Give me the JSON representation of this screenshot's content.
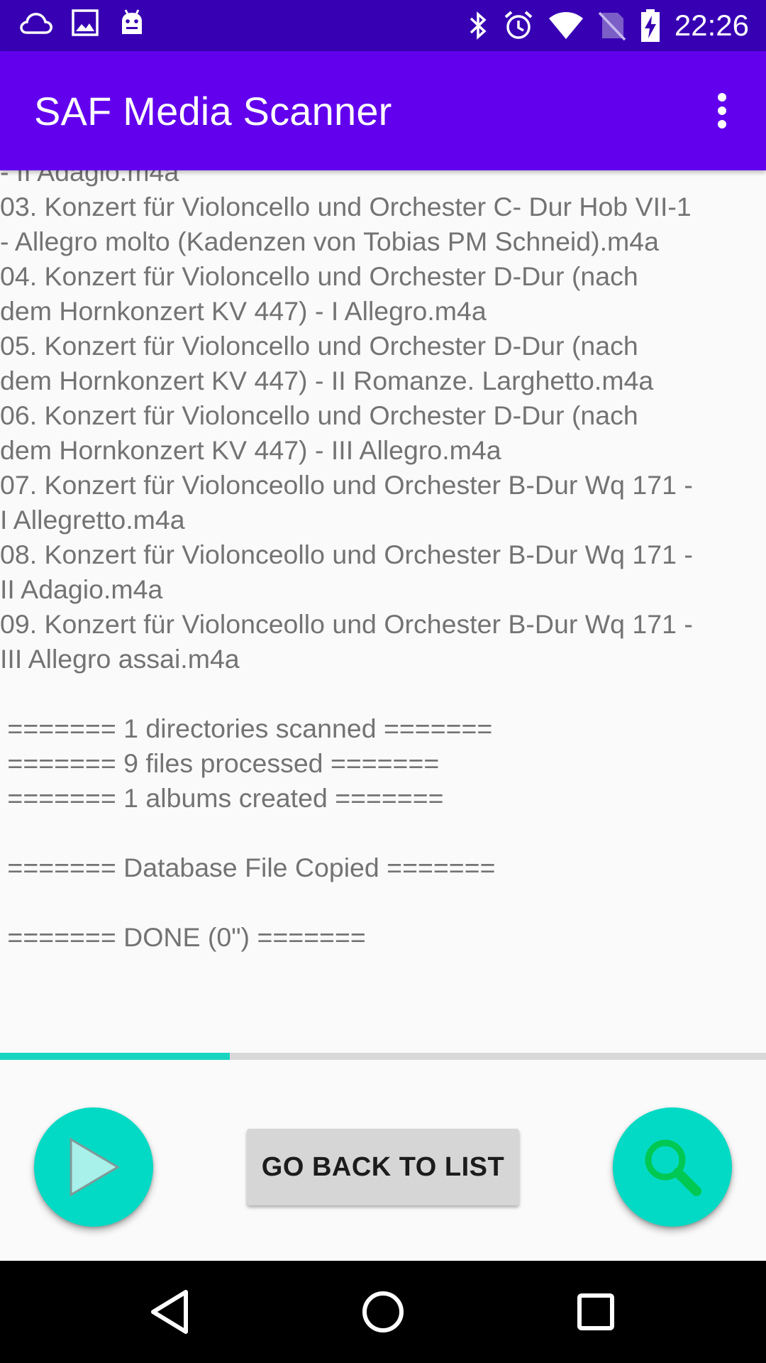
{
  "status_bar": {
    "time": "22:26",
    "left_icons": [
      "cloud-icon",
      "image-icon",
      "android-icon"
    ],
    "right_icons": [
      "bluetooth-icon",
      "alarm-icon",
      "wifi-icon",
      "no-sim-icon",
      "battery-charging-icon"
    ]
  },
  "app_bar": {
    "title": "SAF Media Scanner",
    "menu_icon": "more-vert-icon"
  },
  "log": {
    "text": "- II Adagio.m4a\n03. Konzert für Violoncello und Orchester C- Dur Hob VII-1\n- Allegro molto (Kadenzen von Tobias PM Schneid).m4a\n04. Konzert für Violoncello und Orchester D-Dur (nach\ndem Hornkonzert KV 447) - I Allegro.m4a\n05. Konzert für Violoncello und Orchester D-Dur (nach\ndem Hornkonzert KV 447) - II Romanze. Larghetto.m4a\n06. Konzert für Violoncello und Orchester D-Dur (nach\ndem Hornkonzert KV 447) - III Allegro.m4a\n07. Konzert für Violonceollo und Orchester B-Dur Wq 171 -\nI Allegretto.m4a\n08. Konzert für Violonceollo und Orchester B-Dur Wq 171 -\nII Adagio.m4a\n09. Konzert für Violonceollo und Orchester B-Dur Wq 171 -\nIII Allegro assai.m4a\n\n ======= 1 directories scanned =======\n ======= 9 files processed =======\n ======= 1 albums created =======\n\n ======= Database File Copied =======\n\n ======= DONE (0\") ======="
  },
  "progress": {
    "fraction": 0.3
  },
  "buttons": {
    "play_icon": "play-icon",
    "search_icon": "search-icon",
    "go_back_label": "GO BACK TO LIST"
  },
  "nav_bar": {
    "icons": [
      "nav-back-icon",
      "nav-home-icon",
      "nav-recents-icon"
    ]
  },
  "colors": {
    "status_bar": "#3700b3",
    "app_bar": "#6200ee",
    "fab": "#03dac5",
    "progress": "#18d5c0",
    "search_icon": "#00c853"
  }
}
